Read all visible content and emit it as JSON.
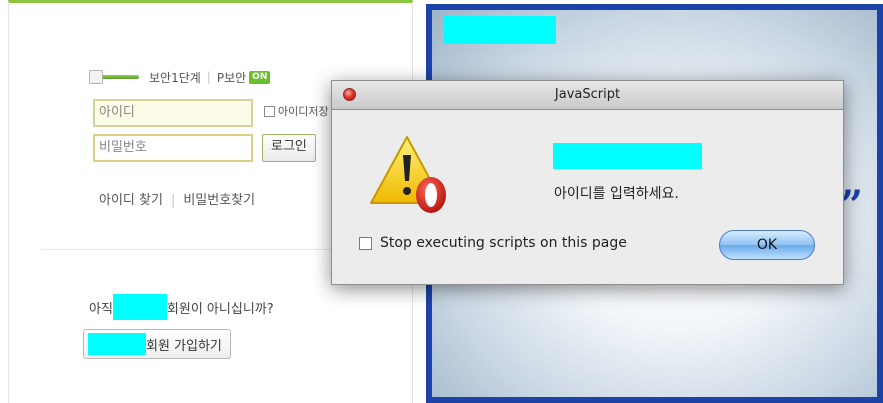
{
  "login": {
    "security_level": "보안1단계",
    "p_security": "P보안",
    "on_badge": "ON",
    "id_placeholder": "아이디",
    "save_id_label": "아이디저장",
    "pw_placeholder": "비밀번호",
    "login_button": "로그인",
    "find_id": "아이디 찾기",
    "find_pw": "비밀번호찾기",
    "not_member_prefix": "아직",
    "not_member_suffix": "회원이 아니십니까?",
    "signup_label": "회원 가입하기"
  },
  "dialog": {
    "title": "JavaScript",
    "message": "아이디를 입력하세요.",
    "stop_scripts_label": "Stop executing scripts on this page",
    "ok_label": "OK",
    "icon": "warning-opera-icon"
  },
  "banner": {
    "quote_mark": "”"
  },
  "colors": {
    "accent_green": "#8cc63f",
    "banner_blue": "#1b43a8",
    "redaction": "#00ffff"
  }
}
